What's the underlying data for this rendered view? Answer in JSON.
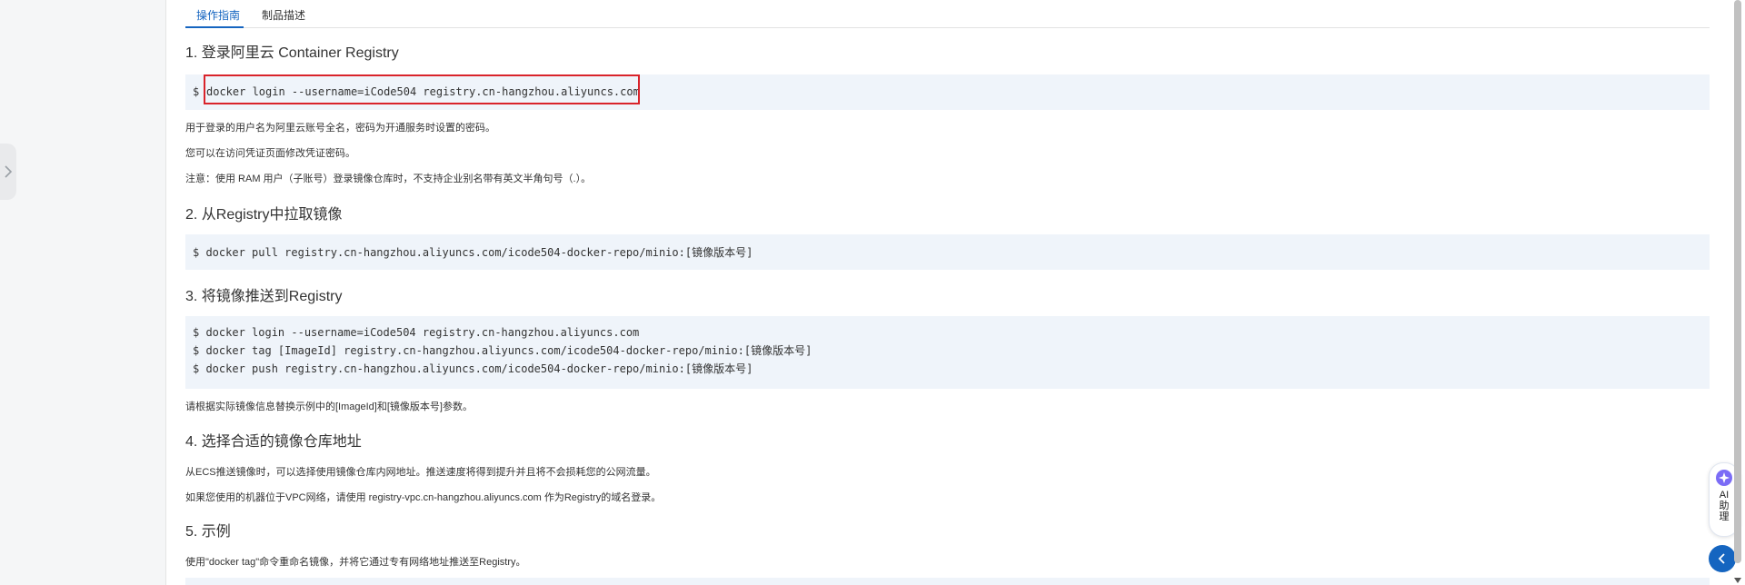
{
  "tabs": [
    {
      "label": "操作指南",
      "active": true
    },
    {
      "label": "制品描述",
      "active": false
    }
  ],
  "sections": {
    "s1": {
      "title": "1. 登录阿里云 Container Registry",
      "prompt": "$",
      "code": "docker login --username=iCode504 registry.cn-hangzhou.aliyuncs.com",
      "notes": [
        "用于登录的用户名为阿里云账号全名，密码为开通服务时设置的密码。",
        "您可以在访问凭证页面修改凭证密码。",
        "注意：使用 RAM 用户（子账号）登录镜像仓库时，不支持企业别名带有英文半角句号（.）。"
      ]
    },
    "s2": {
      "title": "2. 从Registry中拉取镜像",
      "code": "$ docker pull registry.cn-hangzhou.aliyuncs.com/icode504-docker-repo/minio:[镜像版本号]"
    },
    "s3": {
      "title": "3. 将镜像推送到Registry",
      "code_lines": [
        "$ docker login --username=iCode504 registry.cn-hangzhou.aliyuncs.com",
        "$ docker tag [ImageId] registry.cn-hangzhou.aliyuncs.com/icode504-docker-repo/minio:[镜像版本号]",
        "$ docker push registry.cn-hangzhou.aliyuncs.com/icode504-docker-repo/minio:[镜像版本号]"
      ],
      "note": "请根据实际镜像信息替换示例中的[ImageId]和[镜像版本号]参数。"
    },
    "s4": {
      "title": "4. 选择合适的镜像仓库地址",
      "notes": [
        "从ECS推送镜像时，可以选择使用镜像仓库内网地址。推送速度将得到提升并且将不会损耗您的公网流量。",
        "如果您使用的机器位于VPC网络，请使用 registry-vpc.cn-hangzhou.aliyuncs.com 作为Registry的域名登录。"
      ]
    },
    "s5": {
      "title": "5. 示例",
      "note": "使用\"docker tag\"命令重命名镜像，并将它通过专有网络地址推送至Registry。"
    }
  },
  "ai_assistant": {
    "label": "AI助理"
  },
  "colors": {
    "accent": "#1565c0",
    "code_bg": "#eff4fa",
    "highlight": "#d9232a"
  }
}
